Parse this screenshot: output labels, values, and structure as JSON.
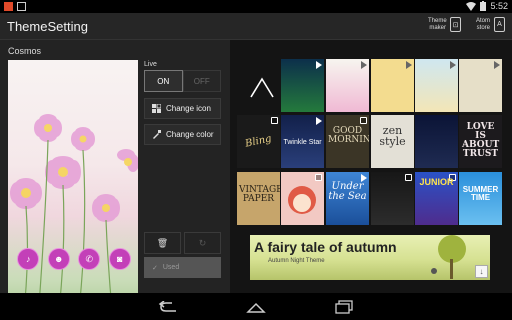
{
  "status_bar": {
    "time": "5:52"
  },
  "action_bar": {
    "title": "ThemeSetting",
    "theme_maker_label": "Theme maker",
    "atom_store_label": "Atom store"
  },
  "current_theme": {
    "name": "Cosmos",
    "live_label": "Live",
    "live_on": "ON",
    "live_off": "OFF",
    "change_icon": "Change icon",
    "change_color": "Change color",
    "used_label": "Used"
  },
  "grid": {
    "tiles": [
      {
        "row": 0,
        "text": "",
        "badge": "play"
      },
      {
        "row": 0,
        "text": "",
        "badge": "play"
      },
      {
        "row": 0,
        "text": "",
        "badge": "play"
      },
      {
        "row": 0,
        "text": "",
        "badge": "play"
      },
      {
        "row": 0,
        "text": "",
        "badge": "play"
      },
      {
        "row": 1,
        "text": "Bling",
        "badge": "copy"
      },
      {
        "row": 1,
        "text": "Twinkle Star",
        "badge": "play"
      },
      {
        "row": 1,
        "text": "GOOD MORNING",
        "badge": "copy"
      },
      {
        "row": 1,
        "text": "zen style",
        "badge": ""
      },
      {
        "row": 1,
        "text": "",
        "badge": ""
      },
      {
        "row": 1,
        "text": "LOVE IS ABOUT TRUST",
        "badge": ""
      },
      {
        "row": 2,
        "text": "VINTAGE PAPER",
        "badge": ""
      },
      {
        "row": 2,
        "text": "",
        "badge": "copy"
      },
      {
        "row": 2,
        "text": "Under the Sea",
        "badge": "play"
      },
      {
        "row": 2,
        "text": "",
        "badge": "copy"
      },
      {
        "row": 2,
        "text": "JUNIOR",
        "badge": "copy"
      },
      {
        "row": 2,
        "text": "SUMMER TIME",
        "badge": ""
      }
    ]
  },
  "banner": {
    "title": "A fairy tale of autumn",
    "subtitle": "Autumn Night Theme"
  },
  "colors": {
    "accent": "#c340b8",
    "background": "#141414"
  }
}
